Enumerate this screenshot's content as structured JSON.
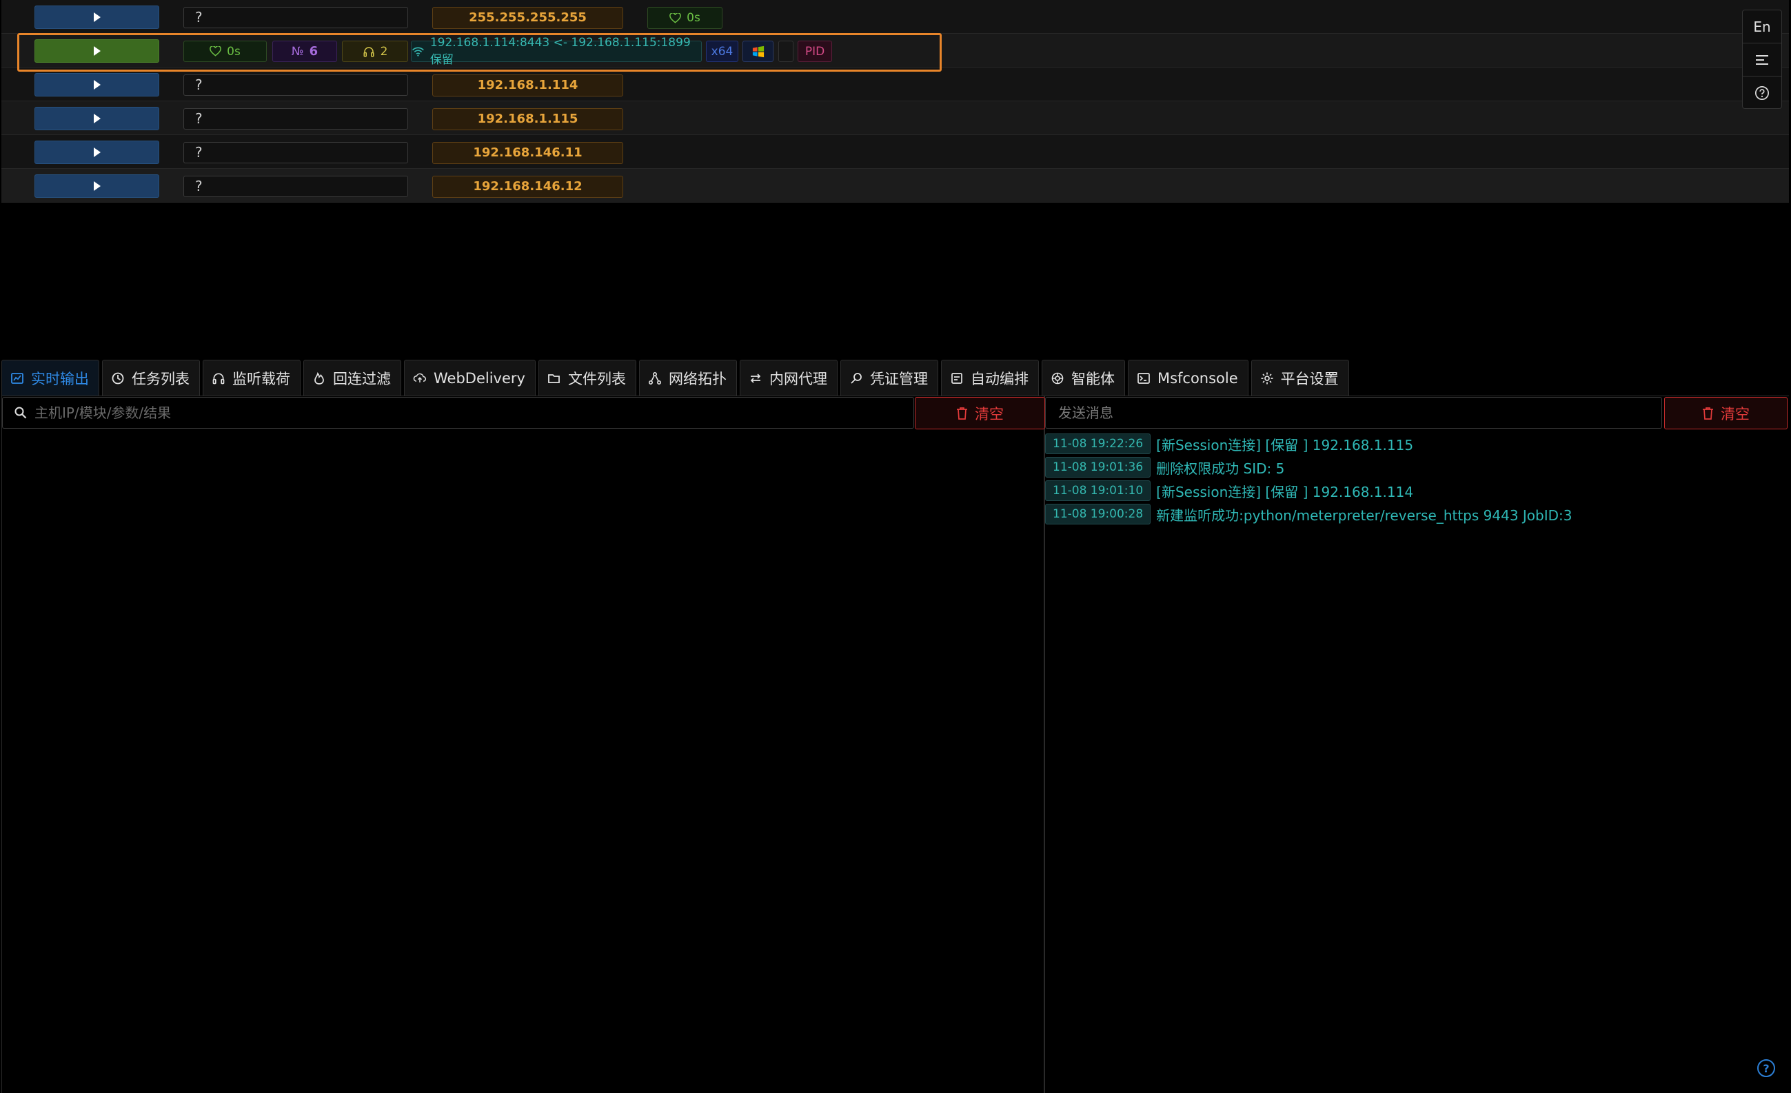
{
  "hosts": [
    {
      "type": "unknown",
      "host_label": "?",
      "ip": "255.255.255.255",
      "heartbeat": "0s"
    },
    {
      "type": "session",
      "heartbeat": "0s",
      "session_no_prefix": "№",
      "session_no": "6",
      "listener_count": "2",
      "connection": "192.168.1.114:8443 <- 192.168.1.115:1899 保留",
      "arch": "x64",
      "pid_label": "PID"
    },
    {
      "type": "unknown",
      "host_label": "?",
      "ip": "192.168.1.114"
    },
    {
      "type": "unknown",
      "host_label": "?",
      "ip": "192.168.1.115"
    },
    {
      "type": "unknown",
      "host_label": "?",
      "ip": "192.168.146.11"
    },
    {
      "type": "unknown",
      "host_label": "?",
      "ip": "192.168.146.12"
    }
  ],
  "side_tools": {
    "lang": "En"
  },
  "tabs": [
    {
      "label": "实时输出",
      "icon": "realtime-icon",
      "active": true
    },
    {
      "label": "任务列表",
      "icon": "clock-icon"
    },
    {
      "label": "监听载荷",
      "icon": "headset-icon"
    },
    {
      "label": "回连过滤",
      "icon": "fire-icon"
    },
    {
      "label": "WebDelivery",
      "icon": "cloud-icon"
    },
    {
      "label": "文件列表",
      "icon": "folder-icon"
    },
    {
      "label": "网络拓扑",
      "icon": "topology-icon"
    },
    {
      "label": "内网代理",
      "icon": "swap-icon"
    },
    {
      "label": "凭证管理",
      "icon": "key-icon"
    },
    {
      "label": "自动编排",
      "icon": "robot-icon"
    },
    {
      "label": "智能体",
      "icon": "agent-icon"
    },
    {
      "label": "Msfconsole",
      "icon": "terminal-icon"
    },
    {
      "label": "平台设置",
      "icon": "gear-icon"
    }
  ],
  "left_pane": {
    "search_placeholder": "主机IP/模块/参数/结果",
    "clear_label": "清空"
  },
  "right_pane": {
    "message_placeholder": "发送消息",
    "clear_label": "清空",
    "log": [
      {
        "time": "11-08 19:22:26",
        "text": "[新Session连接] [保留 ] 192.168.1.115"
      },
      {
        "time": "11-08 19:01:36",
        "text": "删除权限成功 SID: 5"
      },
      {
        "time": "11-08 19:01:10",
        "text": "[新Session连接] [保留 ] 192.168.1.114"
      },
      {
        "time": "11-08 19:00:28",
        "text": "新建监听成功:python/meterpreter/reverse_https 9443 JobID:3"
      }
    ]
  },
  "colors": {
    "accent": "#2f8ae6",
    "warning_ip": "#e8a53b",
    "heartbeat": "#6bbf44",
    "log_text": "#2fb8b6",
    "danger": "#e33b3b",
    "highlight_frame": "#e8852a"
  }
}
